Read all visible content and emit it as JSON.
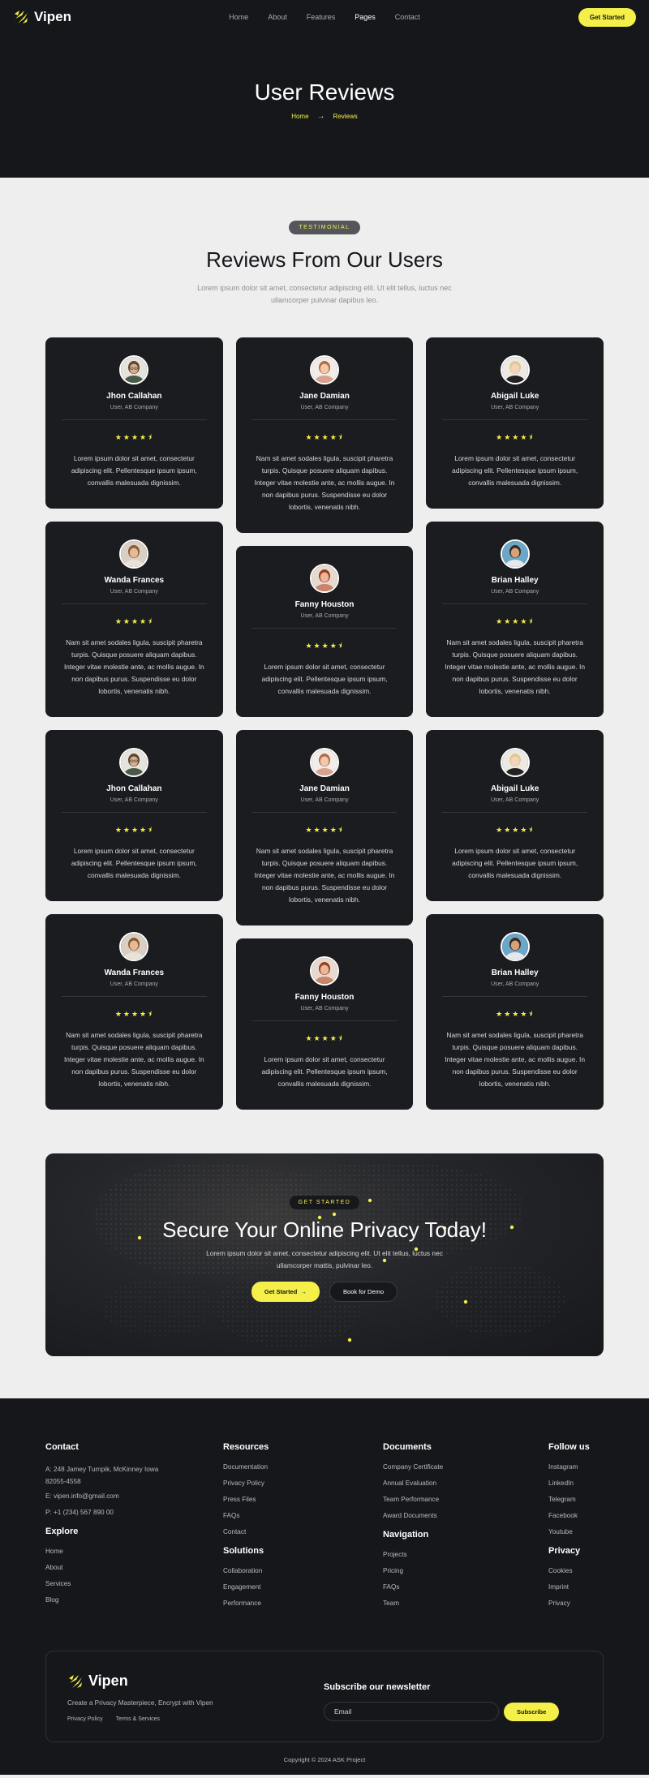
{
  "brand": {
    "name": "Vipen"
  },
  "colors": {
    "accent": "#f5ef4a",
    "dark": "#16171b",
    "card": "#1b1c20",
    "light_bg": "#eeeeee"
  },
  "nav": {
    "items": [
      "Home",
      "About",
      "Features",
      "Pages",
      "Contact"
    ],
    "active": "Pages",
    "cta": "Get Started"
  },
  "hero": {
    "title": "User Reviews",
    "breadcrumb": {
      "home": "Home",
      "separator": "→",
      "current": "Reviews"
    }
  },
  "testimonials": {
    "badge": "TESTIMONIAL",
    "title": "Reviews From Our Users",
    "subtitle": "Lorem ipsum dolor sit amet, consectetur adipiscing elit. Ut elit tellus, luctus nec ullamcorper pulvinar dapibus leo.",
    "rating_display": "★★★★⯨",
    "cards": [
      {
        "name": "Jhon Callahan",
        "role": "User, AB Company",
        "rating": 4.5,
        "text": "Lorem ipsum dolor sit amet, consectetur adipiscing elit. Pellentesque ipsum ipsum, convallis malesuada dignissim.",
        "avatar_icon": "man-glasses-avatar-icon"
      },
      {
        "name": "Jane Damian",
        "role": "User, AB Company",
        "rating": 4.5,
        "text": "Nam sit amet sodales ligula, suscipit pharetra turpis. Quisque posuere aliquam dapibus. Integer vitae molestie ante, ac mollis augue. In non dapibus purus. Suspendisse eu dolor lobortis, venenatis nibh.",
        "avatar_icon": "woman-avatar-icon"
      },
      {
        "name": "Abigail Luke",
        "role": "User, AB Company",
        "rating": 4.5,
        "text": "Lorem ipsum dolor sit amet, consectetur adipiscing elit. Pellentesque ipsum ipsum, convallis malesuada dignissim.",
        "avatar_icon": "woman-blonde-avatar-icon"
      },
      {
        "name": "Wanda Frances",
        "role": "User, AB Company",
        "rating": 4.5,
        "text": "Nam sit amet sodales ligula, suscipit pharetra turpis. Quisque posuere aliquam dapibus. Integer vitae molestie ante, ac mollis augue. In non dapibus purus. Suspendisse eu dolor lobortis, venenatis nibh.",
        "avatar_icon": "woman-curly-avatar-icon"
      },
      {
        "name": "Fanny Houston",
        "role": "User, AB Company",
        "rating": 4.5,
        "text": "Lorem ipsum dolor sit amet, consectetur adipiscing elit. Pellentesque ipsum ipsum, convallis malesuada dignissim.",
        "avatar_icon": "woman-redhead-avatar-icon"
      },
      {
        "name": "Brian Halley",
        "role": "User, AB Company",
        "rating": 4.5,
        "text": "Nam sit amet sodales ligula, suscipit pharetra turpis. Quisque posuere aliquam dapibus. Integer vitae molestie ante, ac mollis augue. In non dapibus purus. Suspendisse eu dolor lobortis, venenatis nibh.",
        "avatar_icon": "man-smiling-avatar-icon"
      },
      {
        "name": "Jhon Callahan",
        "role": "User, AB Company",
        "rating": 4.5,
        "text": "Lorem ipsum dolor sit amet, consectetur adipiscing elit. Pellentesque ipsum ipsum, convallis malesuada dignissim.",
        "avatar_icon": "man-glasses-avatar-icon"
      },
      {
        "name": "Jane Damian",
        "role": "User, AB Company",
        "rating": 4.5,
        "text": "Nam sit amet sodales ligula, suscipit pharetra turpis. Quisque posuere aliquam dapibus. Integer vitae molestie ante, ac mollis augue. In non dapibus purus. Suspendisse eu dolor lobortis, venenatis nibh.",
        "avatar_icon": "woman-avatar-icon"
      },
      {
        "name": "Abigail Luke",
        "role": "User, AB Company",
        "rating": 4.5,
        "text": "Lorem ipsum dolor sit amet, consectetur adipiscing elit. Pellentesque ipsum ipsum, convallis malesuada dignissim.",
        "avatar_icon": "woman-blonde-avatar-icon"
      },
      {
        "name": "Wanda Frances",
        "role": "User, AB Company",
        "rating": 4.5,
        "text": "Nam sit amet sodales ligula, suscipit pharetra turpis. Quisque posuere aliquam dapibus. Integer vitae molestie ante, ac mollis augue. In non dapibus purus. Suspendisse eu dolor lobortis, venenatis nibh.",
        "avatar_icon": "woman-curly-avatar-icon"
      },
      {
        "name": "Fanny Houston",
        "role": "User, AB Company",
        "rating": 4.5,
        "text": "Lorem ipsum dolor sit amet, consectetur adipiscing elit. Pellentesque ipsum ipsum, convallis malesuada dignissim.",
        "avatar_icon": "woman-redhead-avatar-icon"
      },
      {
        "name": "Brian Halley",
        "role": "User, AB Company",
        "rating": 4.5,
        "text": "Nam sit amet sodales ligula, suscipit pharetra turpis. Quisque posuere aliquam dapibus. Integer vitae molestie ante, ac mollis augue. In non dapibus purus. Suspendisse eu dolor lobortis, venenatis nibh.",
        "avatar_icon": "man-smiling-avatar-icon"
      }
    ]
  },
  "cta": {
    "badge": "GET STARTED",
    "title": "Secure Your Online Privacy Today!",
    "text": "Lorem ipsum dolor sit amet, consectetur adipiscing elit. Ut elit tellus, luctus nec ullamcorper mattis, pulvinar leo.",
    "primary": "Get Started",
    "primary_icon": "arrow-right-icon",
    "secondary": "Book for Demo"
  },
  "footer": {
    "contact": {
      "title": "Contact",
      "address": "A: 248 Jamey Turnpik, McKinney Iowa 82055-4558",
      "email": "E: vipen.info@gmail.com",
      "phone": "P: +1 (234) 567 890 00"
    },
    "explore": {
      "title": "Explore",
      "links": [
        "Home",
        "About",
        "Services",
        "Blog"
      ]
    },
    "resources": {
      "title": "Resources",
      "links": [
        "Documentation",
        "Privacy Policy",
        "Press Files",
        "FAQs",
        "Contact"
      ]
    },
    "solutions": {
      "title": "Solutions",
      "links": [
        "Collaboration",
        "Engagement",
        "Performance"
      ]
    },
    "documents": {
      "title": "Documents",
      "links": [
        "Company Certificate",
        "Annual Evaluation",
        "Team Performance",
        "Award Documents"
      ]
    },
    "navigation": {
      "title": "Navigation",
      "links": [
        "Projects",
        "Pricing",
        "FAQs",
        "Team"
      ]
    },
    "follow": {
      "title": "Follow us",
      "links": [
        "Instagram",
        "LinkedIn",
        "Telegram",
        "Facebook",
        "Youtube"
      ]
    },
    "privacy": {
      "title": "Privacy",
      "links": [
        "Cookies",
        "Imprint",
        "Privacy"
      ]
    },
    "box": {
      "tagline": "Create a Privacy Masterpiece, Encrypt with Vipen",
      "links": [
        "Privacy Policy",
        "Terms & Services"
      ],
      "newsletter_title": "Subscribe our newsletter",
      "email_placeholder": "Email",
      "subscribe": "Subscribe"
    },
    "copyright": "Copyright © 2024 ASK Project"
  }
}
